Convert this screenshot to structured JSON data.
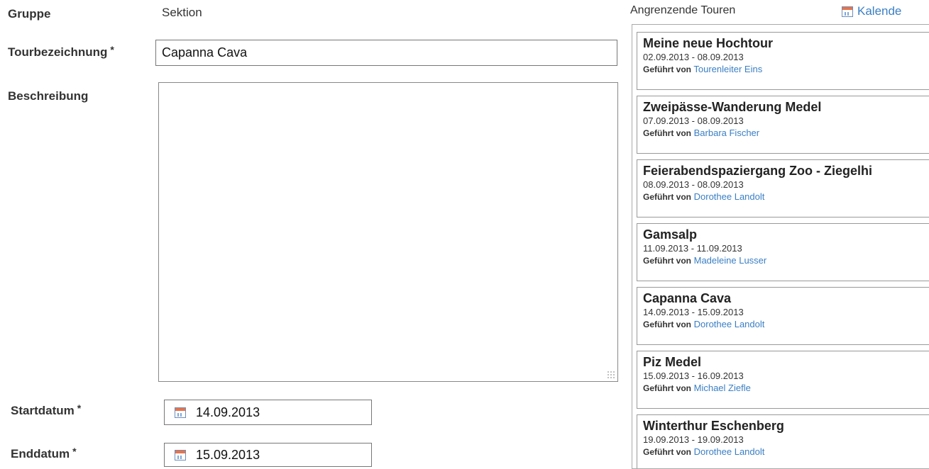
{
  "form": {
    "gruppe_label": "Gruppe",
    "gruppe_value": "Sektion",
    "tourbezeichnung_label": "Tourbezeichnung",
    "tourbezeichnung_value": "Capanna Cava",
    "beschreibung_label": "Beschreibung",
    "beschreibung_value": "",
    "startdatum_label": "Startdatum",
    "startdatum_value": "14.09.2013",
    "enddatum_label": "Enddatum",
    "enddatum_value": "15.09.2013",
    "required_marker": "*"
  },
  "sidebar": {
    "title": "Angrenzende Touren",
    "calendar_link": "Kalende",
    "led_by_label": "Geführt von",
    "tours": [
      {
        "title": "Meine neue Hochtour",
        "dates": "02.09.2013 - 08.09.2013",
        "leader": "Tourenleiter Eins"
      },
      {
        "title": "Zweipässe-Wanderung Medel",
        "dates": "07.09.2013 - 08.09.2013",
        "leader": "Barbara Fischer"
      },
      {
        "title": "Feierabendspaziergang Zoo - Ziegelhi",
        "dates": "08.09.2013 - 08.09.2013",
        "leader": "Dorothee Landolt"
      },
      {
        "title": "Gamsalp",
        "dates": "11.09.2013 - 11.09.2013",
        "leader": "Madeleine Lusser"
      },
      {
        "title": "Capanna Cava",
        "dates": "14.09.2013 - 15.09.2013",
        "leader": "Dorothee Landolt"
      },
      {
        "title": "Piz Medel",
        "dates": "15.09.2013 - 16.09.2013",
        "leader": "Michael Ziefle"
      },
      {
        "title": "Winterthur Eschenberg",
        "dates": "19.09.2013 - 19.09.2013",
        "leader": "Dorothee Landolt"
      }
    ]
  },
  "icons": {
    "calendar": "calendar-icon"
  }
}
